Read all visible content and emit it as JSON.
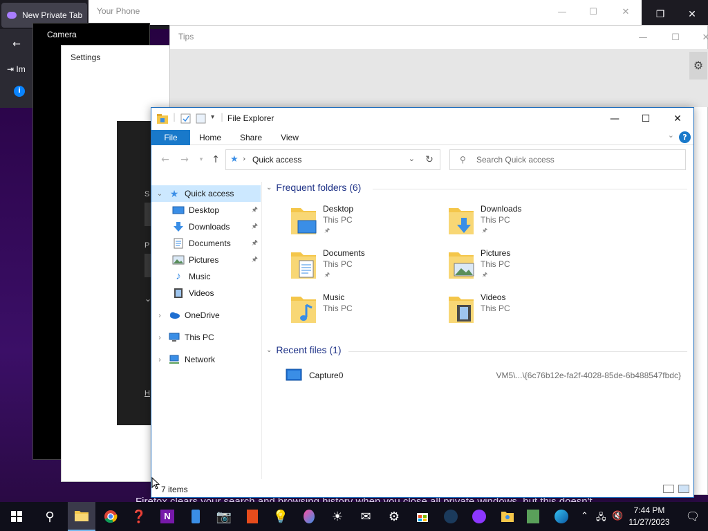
{
  "firefox": {
    "tab_label": "New Private Tab",
    "toolbar_import": "Im",
    "bottom_text": "Firefox clears your search and browsing history when you close all private windows, but this doesn't"
  },
  "phone": {
    "title": "Your Phone"
  },
  "camera": {
    "title": "Camera"
  },
  "settings": {
    "title": "Settings",
    "letters": [
      "S",
      "P",
      "H"
    ]
  },
  "tips": {
    "title": "Tips"
  },
  "explorer": {
    "title": "File Explorer",
    "ribbon": {
      "file": "File",
      "home": "Home",
      "share": "Share",
      "view": "View"
    },
    "address": {
      "location": "Quick access"
    },
    "search": {
      "placeholder": "Search Quick access"
    },
    "nav": {
      "quick_access": "Quick access",
      "items": [
        {
          "label": "Desktop",
          "pinned": true
        },
        {
          "label": "Downloads",
          "pinned": true
        },
        {
          "label": "Documents",
          "pinned": true
        },
        {
          "label": "Pictures",
          "pinned": true
        },
        {
          "label": "Music",
          "pinned": false
        },
        {
          "label": "Videos",
          "pinned": false
        }
      ],
      "onedrive": "OneDrive",
      "this_pc": "This PC",
      "network": "Network"
    },
    "frequent": {
      "header": "Frequent folders (6)",
      "folders": [
        {
          "name": "Desktop",
          "location": "This PC",
          "pinned": true
        },
        {
          "name": "Downloads",
          "location": "This PC",
          "pinned": true
        },
        {
          "name": "Documents",
          "location": "This PC",
          "pinned": true
        },
        {
          "name": "Pictures",
          "location": "This PC",
          "pinned": true
        },
        {
          "name": "Music",
          "location": "This PC",
          "pinned": false
        },
        {
          "name": "Videos",
          "location": "This PC",
          "pinned": false
        }
      ]
    },
    "recent": {
      "header": "Recent files (1)",
      "files": [
        {
          "name": "Capture0",
          "path": "VM5\\...\\{6c76b12e-fa2f-4028-85de-6b488547fbdc}"
        }
      ]
    },
    "status": {
      "count": "7 items"
    }
  },
  "taskbar": {
    "time": "7:44 PM",
    "date": "11/27/2023"
  },
  "colors": {
    "accent": "#1979ca",
    "selected": "#cce8ff",
    "group_header": "#1e3287",
    "folder": "#f4c64a"
  }
}
